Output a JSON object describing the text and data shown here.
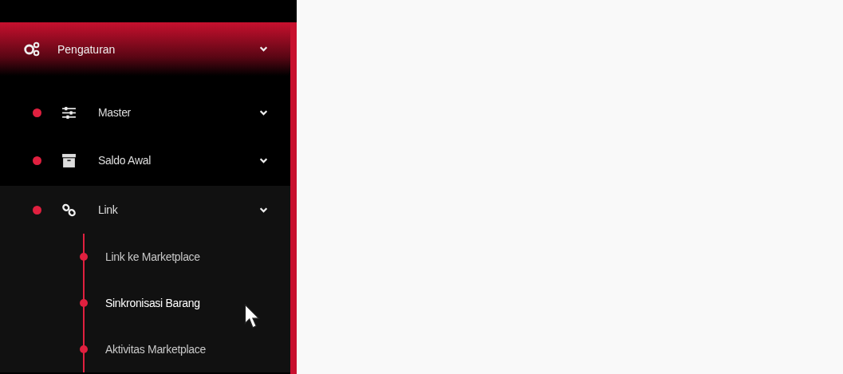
{
  "sidebar": {
    "section": {
      "label": "Pengaturan",
      "expanded": true
    },
    "items": [
      {
        "label": "Master",
        "expanded": false
      },
      {
        "label": "Saldo Awal",
        "expanded": false
      },
      {
        "label": "Link",
        "expanded": true,
        "children": [
          {
            "label": "Link ke Marketplace",
            "selected": false
          },
          {
            "label": "Sinkronisasi Barang",
            "selected": true
          },
          {
            "label": "Aktivitas Marketplace",
            "selected": false
          }
        ]
      }
    ]
  }
}
